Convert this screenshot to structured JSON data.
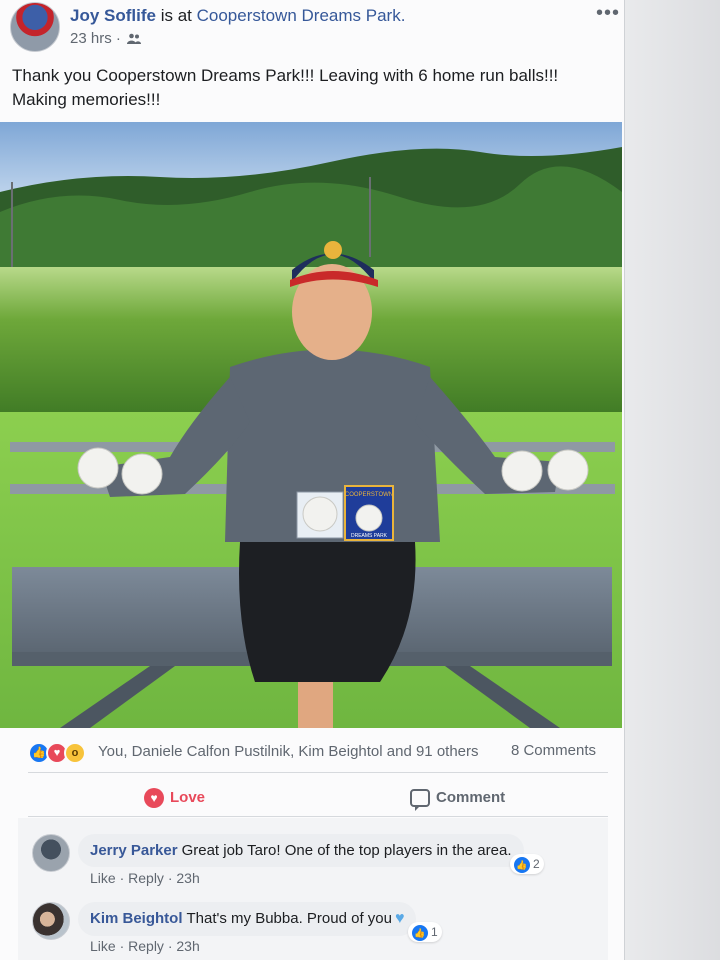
{
  "post": {
    "author": "Joy Soflife",
    "checkin_text": "is at",
    "place": "Cooperstown Dreams Park.",
    "time": "23 hrs",
    "separator": "·",
    "audience_icon": "friends-icon",
    "more_icon": "•••",
    "text_line1": "Thank you Cooperstown Dreams Park!!! Leaving with 6 home run balls!!!",
    "text_line2": "Making memories!!!"
  },
  "photo": {
    "cap_logo_text": "",
    "box_label": "DREAMS PARK",
    "box_top_label": "COOPERSTOWN"
  },
  "reactions": {
    "icons": [
      "like-icon",
      "love-icon",
      "wow-icon"
    ],
    "summary": "You, Daniele Calfon Pustilnik, Kim Beightol and 91 others",
    "comments_count": "8 Comments"
  },
  "actions": {
    "love_label": "Love",
    "comment_label": "Comment"
  },
  "comments": [
    {
      "name": "Jerry Parker",
      "text": "Great job Taro! One of the top players in the area.",
      "like_label": "Like",
      "reply_label": "Reply",
      "time": "23h",
      "reaction_count": "2"
    },
    {
      "name": "Kim Beightol",
      "text": "That's my Bubba. Proud of you",
      "like_label": "Like",
      "reply_label": "Reply",
      "time": "23h",
      "reaction_count": "1"
    }
  ],
  "colors": {
    "link_blue": "#365899",
    "love_red": "#e8495a",
    "like_blue": "#1877f2",
    "meta_gray": "#606770"
  }
}
